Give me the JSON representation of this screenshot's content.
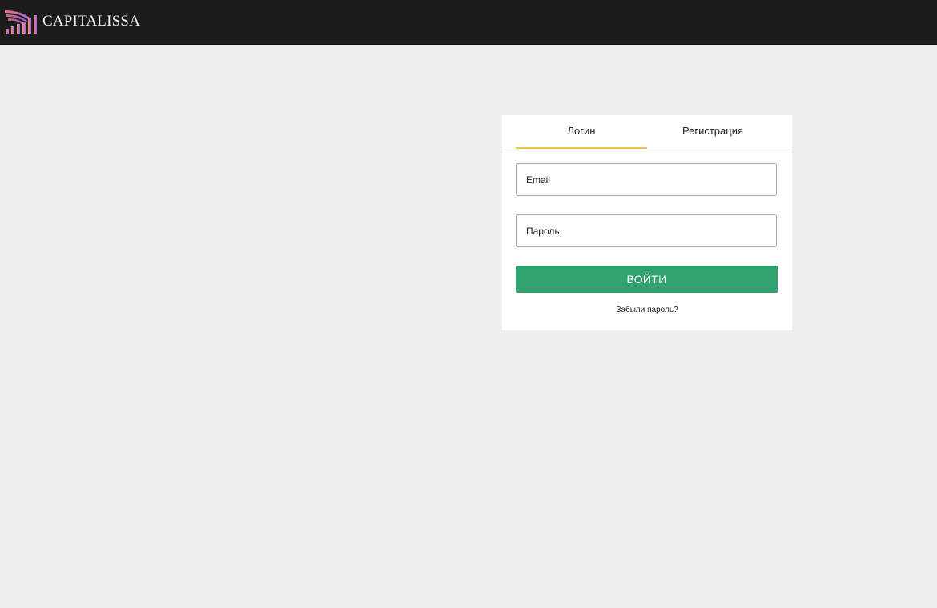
{
  "header": {
    "brand_name": "CAPITALISSA",
    "logo_icon": "wing-bar-chart-logo",
    "background": "#1c1c1c"
  },
  "auth": {
    "tabs": [
      {
        "label": "Логин",
        "active": true
      },
      {
        "label": "Регистрация",
        "active": false
      }
    ],
    "email_placeholder": "Email",
    "password_placeholder": "Пароль",
    "submit_label": "ВОЙТИ",
    "forgot_label": "Забыли пароль?"
  },
  "colors": {
    "accent_tab": "#f2c14e",
    "button": "#33a271",
    "page_background": "#eeeeee"
  }
}
